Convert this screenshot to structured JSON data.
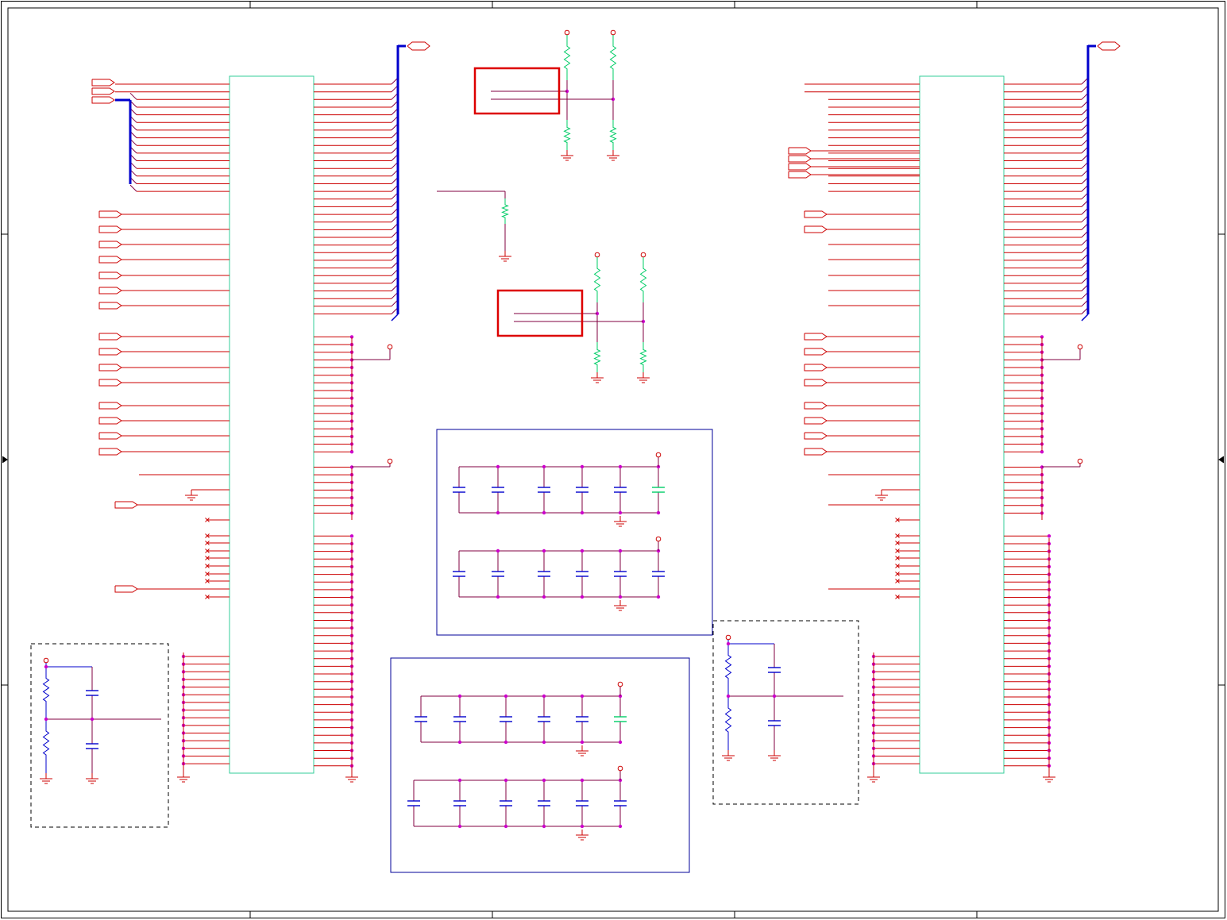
{
  "colors": {
    "frame": "#000000",
    "bus": "#0000cc",
    "net": "#800040",
    "pin": "#cc0000",
    "chip": "#33cc99",
    "junction": "#cc00cc",
    "resistor": "#00cc66",
    "capacitor": "#0000cc",
    "highlight": "#dd0000",
    "group_border": "#000099",
    "dashed_border": "#000000"
  },
  "icons": {
    "power": "power-rail-circle-icon",
    "ground": "ground-symbol-icon",
    "port": "offpage-port-arrow-icon",
    "noconnect": "no-connect-x-icon",
    "junction": "junction-dot-icon",
    "resistor": "resistor-zigzag-icon",
    "capacitor": "capacitor-plates-icon"
  }
}
